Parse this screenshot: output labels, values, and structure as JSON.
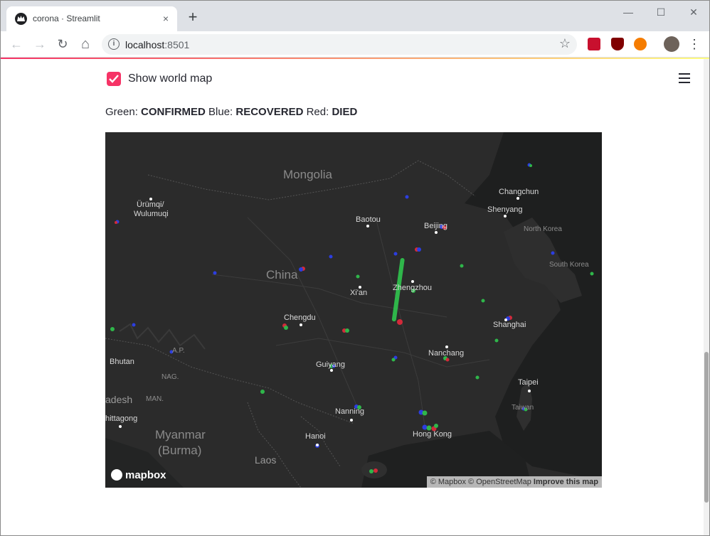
{
  "browser": {
    "tab_title": "corona · Streamlit",
    "tab_close": "×",
    "new_tab": "+",
    "url_host": "localhost",
    "url_port": ":8501",
    "window_controls": {
      "minimize": "—",
      "maximize": "☐",
      "close": "✕"
    },
    "nav": {
      "back": "←",
      "forward": "→",
      "reload": "↻",
      "home": "⌂"
    },
    "menu": "⋮",
    "bookmark_star": "☆",
    "info": "i",
    "icons": [
      "back-icon",
      "forward-icon",
      "reload-icon",
      "home-icon",
      "info-icon",
      "star-icon",
      "extension-icon",
      "avatar",
      "kebab-menu-icon"
    ],
    "accent_colors": {
      "primary": "#f63366",
      "secondary": "#fffd80"
    }
  },
  "app": {
    "checkbox_label": "Show world map",
    "checkbox_checked": true,
    "legend": {
      "green_label": "Green: ",
      "green_value": "CONFIRMED",
      "blue_label": " Blue: ",
      "blue_value": "RECOVERED",
      "red_label": " Red: ",
      "red_value": "DIED"
    },
    "series_colors": {
      "confirmed": "#2fb64a",
      "recovered": "#2c3ee0",
      "died": "#d32a3a"
    }
  },
  "map": {
    "labels": {
      "mongolia": "Mongolia",
      "changchun": "Changchun",
      "shenyang": "Shenyang",
      "urumqi": "Ürümqi/",
      "urumqi2": "Wulumuqi",
      "baotou": "Baotou",
      "beijing": "Beijing",
      "north_korea": "North Korea",
      "south_korea": "South Korea",
      "china": "China",
      "xian": "Xi'an",
      "zhengzhou": "Zhengzhou",
      "chengdu": "Chengdu",
      "shanghai": "Shanghai",
      "ap": "A.P.",
      "nanchang": "Nanchang",
      "bhutan": "Bhutan",
      "nag": "NAG.",
      "guiyang": "Guiyang",
      "taipei": "Taipei",
      "adesh": "adesh",
      "man": "MAN.",
      "taiwan": "Taiwan",
      "nanning": "Nanning",
      "chittagong": "hittagong",
      "myanmar": "Myanmar",
      "burma": "(Burma)",
      "hongkong": "Hong Kong",
      "hanoi": "Hanoi",
      "laos": "Laos"
    },
    "logo": "mapbox",
    "attribution": "© Mapbox © OpenStreetMap",
    "improve": "Improve this map"
  }
}
